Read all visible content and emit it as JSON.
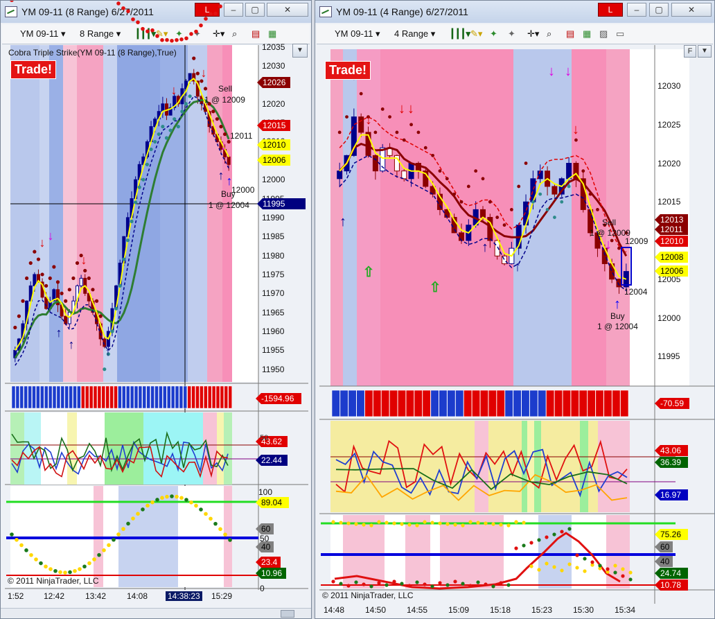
{
  "left": {
    "title": "YM 09-11 (8 Range)  6/27/2011",
    "red_button": "L",
    "toolbar": {
      "instrument": "YM 09-11",
      "interval": "8 Range"
    },
    "indicator_label": "Cobra Triple Strike(YM 09-11 (8 Range),True)",
    "trade_label": "Trade!",
    "price_ticks": [
      "12035",
      "12030",
      "12025",
      "12020",
      "12015",
      "12010",
      "12005",
      "12000",
      "11995",
      "11990",
      "11985",
      "11980",
      "11975",
      "11970",
      "11965",
      "11960",
      "11955",
      "11950"
    ],
    "price_tags": [
      {
        "text": "12026",
        "bg": "#8b0000",
        "fg": "#ffffff"
      },
      {
        "text": "12015",
        "bg": "#e00000",
        "fg": "#ffffff"
      },
      {
        "text": "12010",
        "bg": "#ffff00",
        "fg": "#000000"
      },
      {
        "text": "12006",
        "bg": "#ffff00",
        "fg": "#000000"
      },
      {
        "text": "11995",
        "bg": "#000080",
        "fg": "#ffffff"
      }
    ],
    "annotations": {
      "sell": "Sell",
      "sell_price": "1 @ 12009",
      "level_12011": "12011",
      "level_12000": "12000",
      "buy": "Buy",
      "buy_price": "1 @ 12004"
    },
    "histogram_tag": {
      "text": "-1594.96",
      "bg": "#e00000",
      "fg": "#ffffff"
    },
    "osc_tags": [
      {
        "text": "43.62",
        "bg": "#e00000",
        "fg": "#ffffff"
      },
      {
        "text": "22.44",
        "bg": "#000080",
        "fg": "#ffffff"
      }
    ],
    "stoch_ticks": [
      "100",
      "50",
      "0"
    ],
    "stoch_tags": [
      {
        "text": "89.04",
        "bg": "#ffff00",
        "fg": "#000000"
      },
      {
        "text": "60",
        "bg": "#808080",
        "fg": "#000000"
      },
      {
        "text": "40",
        "bg": "#808080",
        "fg": "#000000"
      },
      {
        "text": "23.4",
        "bg": "#e00000",
        "fg": "#ffffff"
      },
      {
        "text": "10.96",
        "bg": "#006400",
        "fg": "#ffffff"
      }
    ],
    "copyright": "© 2011 NinjaTrader, LLC",
    "time_ticks": [
      "1:52",
      "12:42",
      "13:42",
      "14:08",
      "14:38:23",
      "15:29"
    ]
  },
  "right": {
    "title": "YM 09-11 (4 Range)  6/27/2011",
    "red_button": "L",
    "toolbar": {
      "instrument": "YM 09-11",
      "interval": "4 Range"
    },
    "f_button": "F",
    "trade_label": "Trade!",
    "price_ticks": [
      "12030",
      "12025",
      "12020",
      "12015",
      "12010",
      "12005",
      "12000",
      "11995"
    ],
    "price_tags": [
      {
        "text": "12013",
        "bg": "#8b0000",
        "fg": "#ffffff"
      },
      {
        "text": "12011",
        "bg": "#8b0000",
        "fg": "#ffffff"
      },
      {
        "text": "12010",
        "bg": "#e00000",
        "fg": "#ffffff"
      },
      {
        "text": "12008",
        "bg": "#ffff00",
        "fg": "#000000"
      },
      {
        "text": "12006",
        "bg": "#ffff00",
        "fg": "#000000"
      }
    ],
    "annotations": {
      "sell": "Sell",
      "sell_price": "1 @ 12009",
      "level_12009": "12009",
      "level_12004": "12004",
      "buy": "Buy",
      "buy_price": "1 @ 12004"
    },
    "histogram_tag": {
      "text": "-70.59",
      "bg": "#e00000",
      "fg": "#ffffff"
    },
    "osc_tags": [
      {
        "text": "43.06",
        "bg": "#e00000",
        "fg": "#ffffff"
      },
      {
        "text": "36.39",
        "bg": "#006400",
        "fg": "#ffffff"
      },
      {
        "text": "16.97",
        "bg": "#0000c0",
        "fg": "#ffffff"
      }
    ],
    "stoch_tags": [
      {
        "text": "75.26",
        "bg": "#ffff00",
        "fg": "#000000"
      },
      {
        "text": "60",
        "bg": "#808080",
        "fg": "#000000"
      },
      {
        "text": "40",
        "bg": "#808080",
        "fg": "#000000"
      },
      {
        "text": "24.74",
        "bg": "#006400",
        "fg": "#ffffff"
      },
      {
        "text": "10.78",
        "bg": "#e00000",
        "fg": "#ffffff"
      }
    ],
    "copyright": "© 2011 NinjaTrader, LLC",
    "time_ticks": [
      "14:48",
      "14:50",
      "14:55",
      "15:09",
      "15:18",
      "15:23",
      "15:30",
      "15:34"
    ]
  }
}
